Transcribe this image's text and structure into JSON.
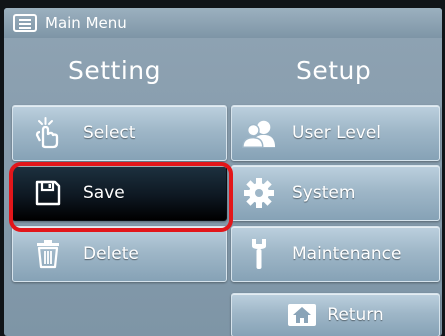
{
  "window": {
    "title": "Main Menu"
  },
  "columns": {
    "left_title": "Setting",
    "right_title": "Setup"
  },
  "left_buttons": [
    {
      "label": "Select",
      "icon": "touch-hand-icon"
    },
    {
      "label": "Save",
      "icon": "floppy-disk-icon",
      "selected": true
    },
    {
      "label": "Delete",
      "icon": "trash-can-icon"
    }
  ],
  "right_buttons": [
    {
      "label": "User Level",
      "icon": "users-icon"
    },
    {
      "label": "System",
      "icon": "gear-icon"
    },
    {
      "label": "Maintenance",
      "icon": "wrench-icon"
    }
  ],
  "return_button": {
    "label": "Return",
    "icon": "home-icon"
  },
  "colors": {
    "highlight": "#e2161a",
    "selected_bg": "#0e1822",
    "panel": "#8fa3b3"
  }
}
